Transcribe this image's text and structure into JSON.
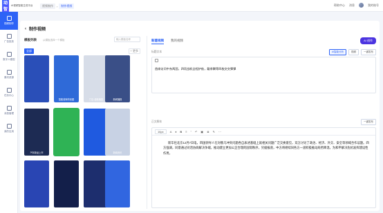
{
  "app": {
    "logo": "灵动智言",
    "logo_sub": "AI视频智能生成平台"
  },
  "breadcrumb": {
    "parent": "视频制作",
    "current": "制作视频"
  },
  "topbar": {
    "notice": "帮助中心",
    "service": "消息",
    "user": "我的账号"
  },
  "sidebar": {
    "items": [
      {
        "label": "视频制作",
        "icon": "video-icon",
        "active": true
      },
      {
        "label": "广告投放",
        "icon": "ad-icon",
        "active": false
      },
      {
        "label": "数字人模型",
        "icon": "avatar-icon",
        "active": false
      },
      {
        "label": "素材资源",
        "icon": "folder-icon",
        "active": false
      },
      {
        "label": "任务中心",
        "icon": "task-icon",
        "active": false
      },
      {
        "label": "消息管理",
        "icon": "chat-icon",
        "active": false
      },
      {
        "label": "我的应用",
        "icon": "apps-icon",
        "active": false
      }
    ]
  },
  "page": {
    "title": "制作视频",
    "back_icon": "back-icon"
  },
  "templates": {
    "title": "模板列表",
    "hint": "从模板选择一个模板",
    "search_placeholder": "输入模板名称",
    "filter_all": "全部",
    "more": "+ 更多",
    "cards": [
      {
        "caption": "",
        "color": "#2a4fb8"
      },
      {
        "caption": "智能营销背景图",
        "color": "#2f6ad8"
      },
      {
        "caption": "门店-金融播报",
        "color": "#d7dde8"
      },
      {
        "caption": "新闻播报",
        "color": "#3a4f87"
      },
      {
        "caption": "汽车新品上市",
        "color": "#1d2b53"
      },
      {
        "caption": "",
        "color": "#2fb355"
      },
      {
        "caption": "",
        "color": "#1f5ae0"
      },
      {
        "caption": "新闻资讯",
        "color": "#c8d2e4"
      },
      {
        "caption": "",
        "color": "#2945b3"
      },
      {
        "caption": "",
        "color": "#131f4a"
      },
      {
        "caption": "",
        "color": "#1d2e6e"
      },
      {
        "caption": "",
        "color": "#3166e0"
      }
    ]
  },
  "editor": {
    "tab_active": "新建视频",
    "tab_other": "我的视频",
    "ai_button": "AI 创作",
    "headline_label": "标题文本",
    "auto_subtitle": "AI智能分析",
    "voice_select": "视频",
    "one_click": "一键发布",
    "headline_text": "首席访问中东两国，四项战机全程护航，戴季腾等四枚交交彈彈",
    "body_label": "正文脚本",
    "font_size": "16px",
    "body_one_click": "一键发布",
    "body_text": "新华社北京12月7日电，四国领导人在对俄乌冲突问题各自表述基础上就相关问题广泛交换意见，双方讨论了政治、经济、外交、安全等领域合作议题。四方强调，同意通过对话协商解决争端，推动建立更加公正合理的国际秩序，另据报道，中方将继续同各方一道积极推动局势降温，为和平解决危机发挥建设性作用。"
  }
}
